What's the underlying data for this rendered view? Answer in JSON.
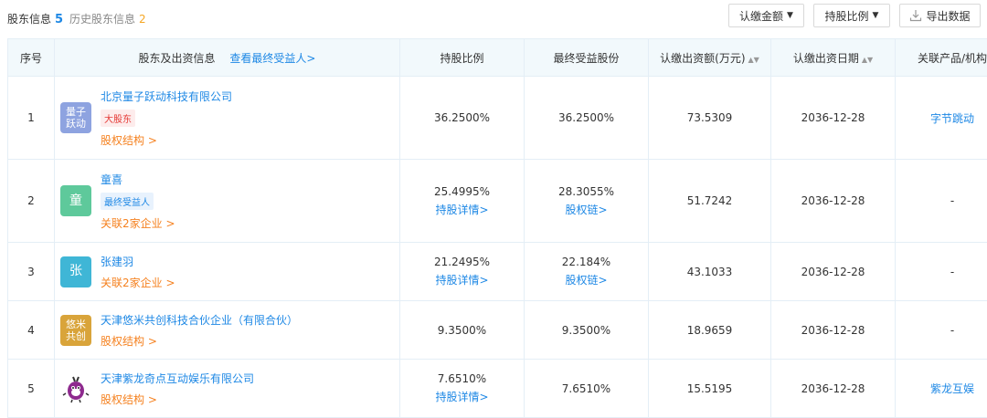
{
  "header": {
    "title": "股东信息",
    "count": "5",
    "history_label": "历史股东信息",
    "history_count": "2",
    "btn_amount": "认缴金额",
    "btn_ratio": "持股比例",
    "btn_export": "导出数据"
  },
  "table": {
    "col_index": "序号",
    "col_holder": "股东及出资信息",
    "col_holder_link": "查看最终受益人>",
    "col_ratio": "持股比例",
    "col_final": "最终受益股份",
    "col_amount": "认缴出资额(万元)",
    "col_date": "认缴出资日期",
    "col_product": "关联产品/机构",
    "rows": [
      {
        "index": "1",
        "avatar": "量子跃动",
        "avatar_color": "#8ea3e0",
        "name": "北京量子跃动科技有限公司",
        "tag": "大股东",
        "sub": "股权结构 >",
        "ratio": "36.2500%",
        "final": "36.2500%",
        "amount": "73.5309",
        "date": "2036-12-28",
        "product": "字节跳动"
      },
      {
        "index": "2",
        "avatar": "童",
        "avatar_color": "#5ec99b",
        "name": "童喜",
        "tag": "最终受益人",
        "sub": "关联2家企业 >",
        "ratio": "25.4995%",
        "ratio_link": "持股详情>",
        "final": "28.3055%",
        "final_link": "股权链>",
        "amount": "51.7242",
        "date": "2036-12-28",
        "product": "-"
      },
      {
        "index": "3",
        "avatar": "张",
        "avatar_color": "#3fb6d6",
        "name": "张建羽",
        "sub": "关联2家企业 >",
        "ratio": "21.2495%",
        "ratio_link": "持股详情>",
        "final": "22.184%",
        "final_link": "股权链>",
        "amount": "43.1033",
        "date": "2036-12-28",
        "product": "-"
      },
      {
        "index": "4",
        "avatar": "悠米共创",
        "avatar_color": "#d9a43a",
        "name": "天津悠米共创科技合伙企业（有限合伙）",
        "sub": "股权结构 >",
        "ratio": "9.3500%",
        "final": "9.3500%",
        "amount": "18.9659",
        "date": "2036-12-28",
        "product": "-"
      },
      {
        "index": "5",
        "avatar": "mascot",
        "name": "天津紫龙奇点互动娱乐有限公司",
        "sub": "股权结构 >",
        "ratio": "7.6510%",
        "ratio_link": "持股详情>",
        "final": "7.6510%",
        "amount": "15.5195",
        "date": "2036-12-28",
        "product": "紫龙互娱"
      }
    ]
  }
}
